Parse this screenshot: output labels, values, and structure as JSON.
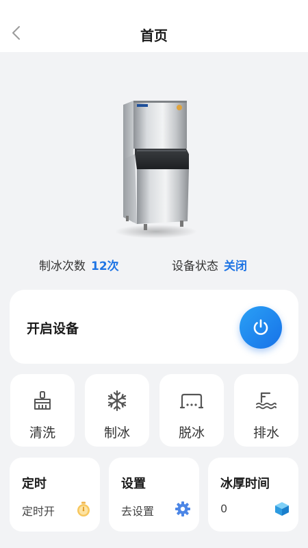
{
  "header": {
    "title": "首页",
    "back_icon": "chevron-left-icon"
  },
  "device": {
    "image": "ice-machine-image"
  },
  "stats": {
    "count_label": "制冰次数",
    "count_value": "12次",
    "status_label": "设备状态",
    "status_value": "关闭"
  },
  "power": {
    "label": "开启设备",
    "icon": "power-icon"
  },
  "functions": [
    {
      "label": "清洗",
      "icon": "brush-icon"
    },
    {
      "label": "制冰",
      "icon": "snowflake-icon"
    },
    {
      "label": "脱冰",
      "icon": "ice-tray-icon"
    },
    {
      "label": "排水",
      "icon": "drain-icon"
    }
  ],
  "info_cards": [
    {
      "title": "定时",
      "subtitle": "定时开",
      "icon": "timer-icon"
    },
    {
      "title": "设置",
      "subtitle": "去设置",
      "icon": "gear-icon"
    },
    {
      "title": "冰厚时间",
      "subtitle": "0",
      "icon": "ice-cube-icon"
    }
  ],
  "colors": {
    "accent": "#1e74e4",
    "background": "#f2f3f5",
    "card": "#ffffff"
  }
}
